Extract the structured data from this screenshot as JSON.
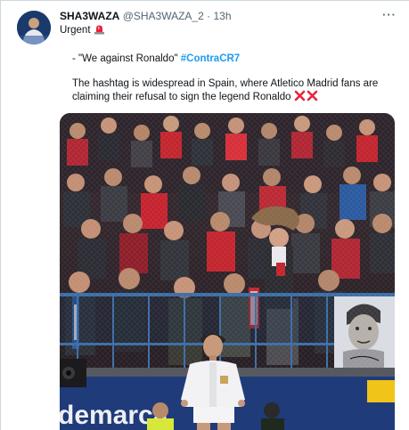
{
  "tweet": {
    "display_name": "SHA3WAZA",
    "handle": "@SHA3WAZA_2",
    "separator": "·",
    "timestamp": "13h",
    "more_label": "···",
    "text_line1": "Urgent",
    "text_quote_prefix": "- \"We against Ronaldo\"",
    "hashtag": "#ContraCR7",
    "text_line3": "The hashtag is widespread in Spain, where Atletico Madrid fans are",
    "text_line4": "claiming their refusal to sign the legend Ronaldo",
    "siren_icon": "police-siren-emoji",
    "cross_icon": "cross-mark-emoji",
    "banner_text": "demarca"
  },
  "colors": {
    "hashtag": "#1d9bf0",
    "text": "#0f1419",
    "muted": "#536471",
    "cross": "#e8243c",
    "siren": "#e8243c"
  }
}
